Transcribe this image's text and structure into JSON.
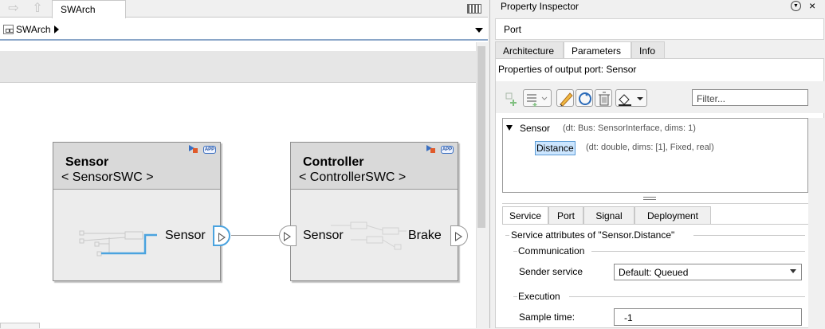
{
  "editor": {
    "tab_label": "SWArch",
    "address_label": "SWArch",
    "blocks": [
      {
        "title": "Sensor",
        "subtitle": "< SensorSWC >",
        "badge": "APP",
        "ports": [
          "Sensor"
        ]
      },
      {
        "title": "Controller",
        "subtitle": "< ControllerSWC >",
        "badge": "APP",
        "ports": [
          "Sensor",
          "Brake"
        ]
      }
    ]
  },
  "inspector": {
    "title": "Property Inspector",
    "element_type": "Port",
    "tabs": [
      "Architecture",
      "Parameters",
      "Info"
    ],
    "active_tab": "Parameters",
    "caption": "Properties of output port: Sensor",
    "filter_placeholder": "Filter...",
    "tree": {
      "root_name": "Sensor",
      "root_meta": "(dt: Bus: SensorInterface, dims: 1)",
      "child_name": "Distance",
      "child_meta": "(dt: double, dims: [1], Fixed, real)"
    },
    "detail_tabs": [
      "Service",
      "Port",
      "Signal",
      "Deployment"
    ],
    "active_detail_tab": "Service",
    "service_header": "Service attributes of \"Sensor.Distance\"",
    "communication_header": "Communication",
    "sender_service_label": "Sender service",
    "sender_service_value": "Default: Queued",
    "execution_header": "Execution",
    "sample_time_label": "Sample time:",
    "sample_time_value": "-1"
  },
  "colors": {
    "selection_blue": "#4aa3df",
    "block_header": "#d9d9d9",
    "app_badge": "#3a6fc0"
  }
}
